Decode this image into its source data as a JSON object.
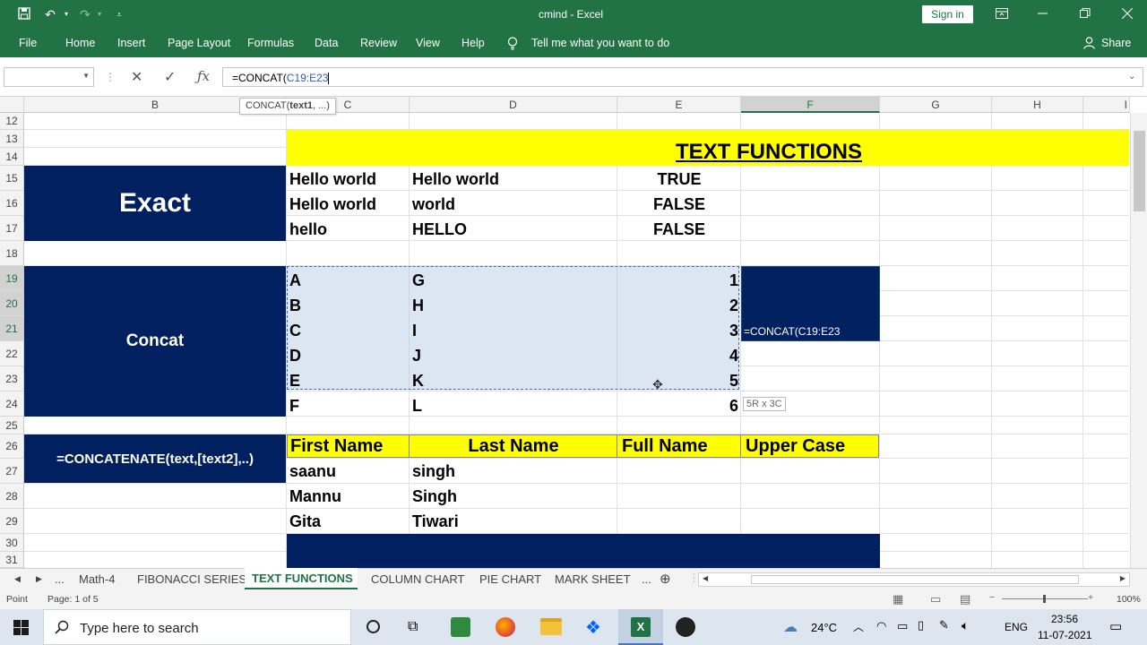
{
  "titlebar": {
    "doc_title": "cmind  -  Excel",
    "sign_in": "Sign in"
  },
  "ribbon": {
    "file": "File",
    "home": "Home",
    "insert": "Insert",
    "page_layout": "Page Layout",
    "formulas": "Formulas",
    "data": "Data",
    "review": "Review",
    "view": "View",
    "help": "Help",
    "tell_me": "Tell me what you want to do",
    "share": "Share"
  },
  "formula_bar": {
    "name_box": "",
    "formula_prefix": "=CONCAT(",
    "formula_ref": "C19:E23",
    "tooltip_fn": "CONCAT(",
    "tooltip_arg": "text1",
    "tooltip_rest": ", ...)"
  },
  "columns": [
    "B",
    "C",
    "D",
    "E",
    "F",
    "G",
    "H",
    "I"
  ],
  "rows": [
    "12",
    "13",
    "14",
    "15",
    "16",
    "17",
    "18",
    "19",
    "20",
    "21",
    "22",
    "23",
    "24",
    "25",
    "26",
    "27",
    "28",
    "29",
    "30",
    "31"
  ],
  "sheet": {
    "title": "TEXT FUNCTIONS",
    "exact_label": "Exact",
    "exact_rows": [
      {
        "c": "Hello world",
        "d": "Hello world",
        "e": "TRUE"
      },
      {
        "c": "Hello world",
        "d": "world",
        "e": "FALSE"
      },
      {
        "c": "hello",
        "d": "HELLO",
        "e": "FALSE"
      }
    ],
    "concat_label": "Concat",
    "concat_rows": [
      {
        "c": "A",
        "d": "G",
        "e": "1"
      },
      {
        "c": "B",
        "d": "H",
        "e": "2"
      },
      {
        "c": "C",
        "d": "I",
        "e": "3"
      },
      {
        "c": "D",
        "d": "J",
        "e": "4"
      },
      {
        "c": "E",
        "d": "K",
        "e": "5"
      },
      {
        "c": "F",
        "d": "L",
        "e": "6"
      }
    ],
    "editing_cell": "=CONCAT(C19:E23",
    "size_hint": "5R x 3C",
    "concatenate_label": "=CONCATENATE(text,[text2],..)",
    "table_headers": [
      "First Name",
      "Last Name",
      "Full Name",
      "Upper Case"
    ],
    "people": [
      {
        "first": "saanu",
        "last": "singh"
      },
      {
        "first": "Mannu",
        "last": "Singh"
      },
      {
        "first": "Gita",
        "last": "Tiwari"
      }
    ]
  },
  "tabs": {
    "ellipsis": "...",
    "items": [
      "Math-4",
      "FIBONACCI SERIES",
      "TEXT FUNCTIONS",
      "COLUMN CHART",
      "PIE CHART",
      "MARK SHEET"
    ],
    "active": "TEXT FUNCTIONS"
  },
  "status": {
    "mode": "Point",
    "page": "Page: 1 of 5",
    "zoom": "100%"
  },
  "taskbar": {
    "search_placeholder": "Type here to search",
    "temperature": "24°C",
    "language": "ENG",
    "time": "23:56",
    "date": "11-07-2021"
  },
  "colors": {
    "excel_green": "#217346",
    "navy": "#002060",
    "yellow": "#ffff00",
    "selection": "#dce6f2"
  }
}
